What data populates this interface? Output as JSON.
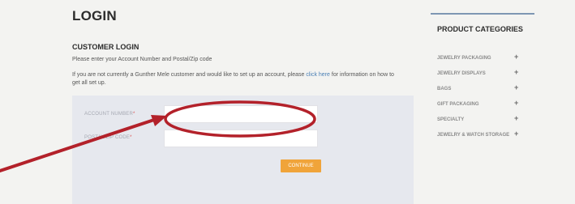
{
  "page": {
    "title": "LOGIN"
  },
  "login": {
    "section_title": "CUSTOMER LOGIN",
    "instructions": "Please enter your Account Number and Postal/Zip code",
    "info_text": "If you are not currently a Gunther Mele customer and would like to set up an account, please",
    "info_link": "click here",
    "info_text_after": "for information on how to get all set up.",
    "account_label": "ACCOUNT NUMBER",
    "zip_label": "POSTAL/ZIP CODE",
    "required_mark": "*",
    "account_value": "",
    "zip_value": "",
    "submit_label": "CONTINUE"
  },
  "sidebar": {
    "title": "PRODUCT CATEGORIES",
    "categories": [
      {
        "label": "JEWELRY PACKAGING",
        "expand": "+"
      },
      {
        "label": "JEWELRY DISPLAYS",
        "expand": "+"
      },
      {
        "label": "BAGS",
        "expand": "+"
      },
      {
        "label": "GIFT PACKAGING",
        "expand": "+"
      },
      {
        "label": "SPECIALTY",
        "expand": "+"
      },
      {
        "label": "JEWELRY & WATCH STORAGE",
        "expand": "+"
      }
    ]
  },
  "annotation": {
    "color": "#b3212a"
  }
}
